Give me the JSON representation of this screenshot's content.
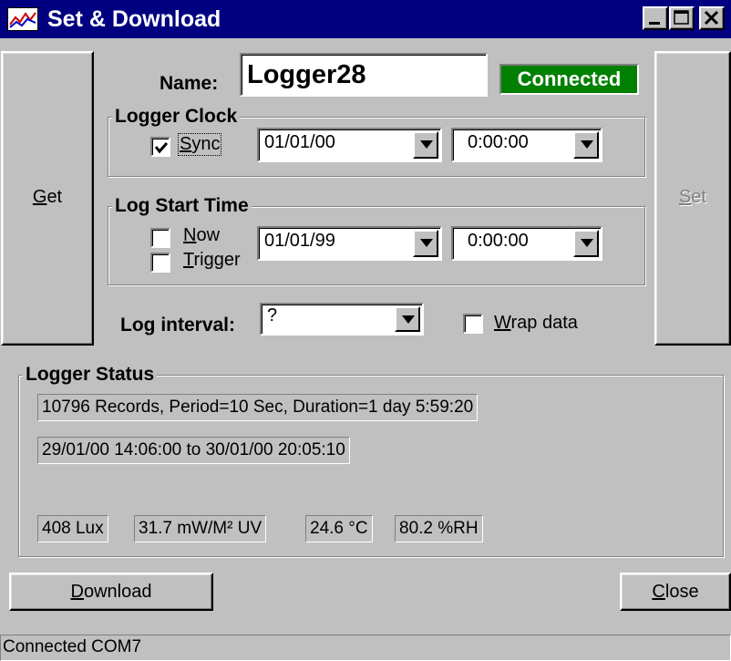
{
  "window": {
    "title": "Set & Download"
  },
  "buttons": {
    "get": {
      "prefix": "",
      "accel": "G",
      "rest": "et"
    },
    "set": {
      "prefix": "",
      "accel": "S",
      "rest": "et"
    },
    "download": {
      "prefix": "",
      "accel": "D",
      "rest": "ownload"
    },
    "close": {
      "prefix": "",
      "accel": "C",
      "rest": "lose"
    }
  },
  "name": {
    "label": "Name:",
    "value": "Logger28"
  },
  "connection_badge": "Connected",
  "logger_clock": {
    "title": "Logger Clock",
    "sync": {
      "checked": true,
      "accel": "S",
      "rest": "ync"
    },
    "date": "01/01/00",
    "time": "0:00:00"
  },
  "log_start_time": {
    "title": "Log Start Time",
    "now": {
      "checked": false,
      "accel": "N",
      "rest": "ow"
    },
    "trigger": {
      "checked": false,
      "accel": "T",
      "rest": "rigger"
    },
    "date": "01/01/99",
    "time": "0:00:00"
  },
  "log_interval": {
    "label": "Log interval:",
    "value": "?"
  },
  "wrap_data": {
    "checked": false,
    "accel": "W",
    "rest": "rap data"
  },
  "logger_status": {
    "title": "Logger Status",
    "records_line": "10796 Records, Period=10 Sec, Duration=1 day 5:59:20",
    "range_line": "29/01/00 14:06:00  to 30/01/00 20:05:10",
    "readings": [
      "408 Lux",
      "31.7 mW/M² UV",
      "24.6 °C",
      "80.2 %RH"
    ]
  },
  "status_bar": "Connected COM7",
  "colors": {
    "titlebar": "#000080",
    "face": "#c0c0c0",
    "connected_badge": "#008000"
  },
  "icons": {
    "app": "chart-line-icon",
    "minimize": "minimize-icon",
    "maximize": "maximize-icon",
    "close": "close-icon",
    "dropdown": "chevron-down-icon",
    "check": "checkmark-icon"
  }
}
